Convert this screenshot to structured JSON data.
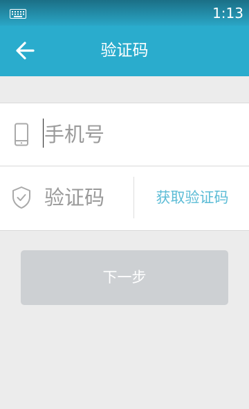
{
  "status_bar": {
    "time": "1:13",
    "left_icon": "keyboard-icon"
  },
  "app_bar": {
    "title": "验证码",
    "back_icon": "arrow-left-icon",
    "background": "#2aaccd"
  },
  "form": {
    "phone": {
      "icon": "phone-icon",
      "placeholder": "手机号",
      "value": ""
    },
    "code": {
      "icon": "shield-check-icon",
      "placeholder": "验证码",
      "value": ""
    },
    "get_code_label": "获取验证码",
    "get_code_color": "#5cbcd6"
  },
  "next_button": {
    "label": "下一步",
    "background": "#cdd0d3"
  }
}
